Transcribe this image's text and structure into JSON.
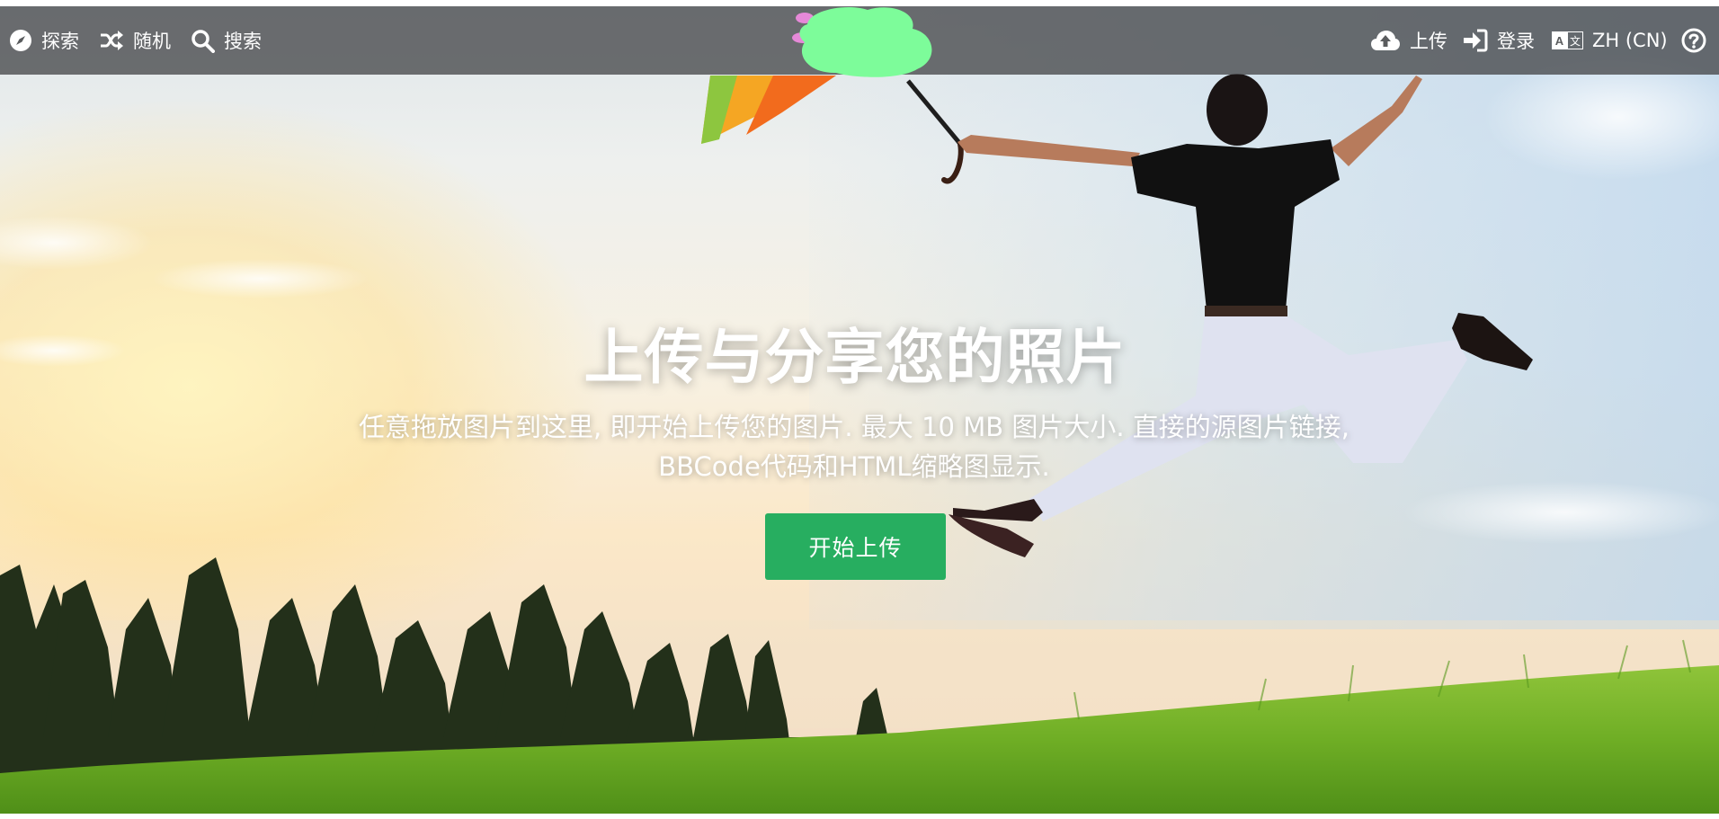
{
  "topbar": {
    "explore_label": "探索",
    "random_label": "随机",
    "search_label": "搜索",
    "upload_label": "上传",
    "login_label": "登录",
    "language_label": "ZH (CN)",
    "language_icon_text": "A 文"
  },
  "hero": {
    "title": "上传与分享您的照片",
    "description": "任意拖放图片到这里, 即开始上传您的图片. 最大 10 MB 图片大小. 直接的源图片链接, BBCode代码和HTML缩略图显示.",
    "start_button_label": "开始上传"
  },
  "colors": {
    "topbar_bg": "#46484a",
    "accent_green": "#27ae60",
    "logo_blob": "#7dfc9a"
  },
  "icons": {
    "explore": "compass-icon",
    "random": "shuffle-icon",
    "search": "search-icon",
    "upload": "cloud-upload-icon",
    "login": "sign-in-icon",
    "language": "language-icon",
    "help": "help-icon"
  }
}
